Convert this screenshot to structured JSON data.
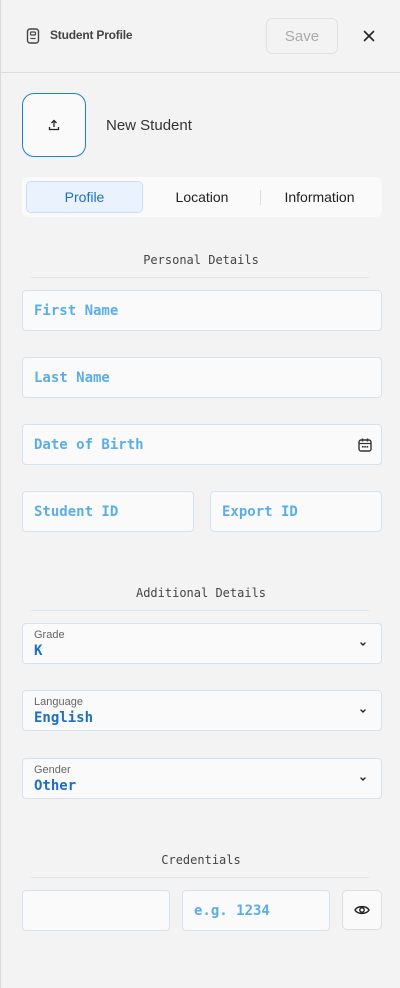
{
  "header": {
    "title": "Student Profile",
    "save_label": "Save",
    "icons": {
      "profile": "id-card-icon",
      "close": "close-icon"
    }
  },
  "student": {
    "name": "New Student",
    "avatar_icon": "upload-icon"
  },
  "tabs": [
    {
      "label": "Profile",
      "active": true
    },
    {
      "label": "Location",
      "active": false
    },
    {
      "label": "Information",
      "active": false
    }
  ],
  "personal": {
    "title": "Personal Details",
    "first_name_placeholder": "First Name",
    "last_name_placeholder": "Last Name",
    "dob_placeholder": "Date of Birth",
    "student_id_placeholder": "Student ID",
    "export_id_placeholder": "Export ID"
  },
  "additional": {
    "title": "Additional Details",
    "grade": {
      "label": "Grade",
      "value": "K"
    },
    "language": {
      "label": "Language",
      "value": "English"
    },
    "gender": {
      "label": "Gender",
      "value": "Other"
    }
  },
  "credentials": {
    "title": "Credentials",
    "username_value": "",
    "pin_placeholder": "e.g. 1234",
    "visibility_icon": "eye-icon"
  },
  "colors": {
    "accent": "#1c6fc2",
    "placeholder": "#5aaee8",
    "background": "#f3f3f3",
    "tab_active_bg": "#eaf3fd"
  }
}
